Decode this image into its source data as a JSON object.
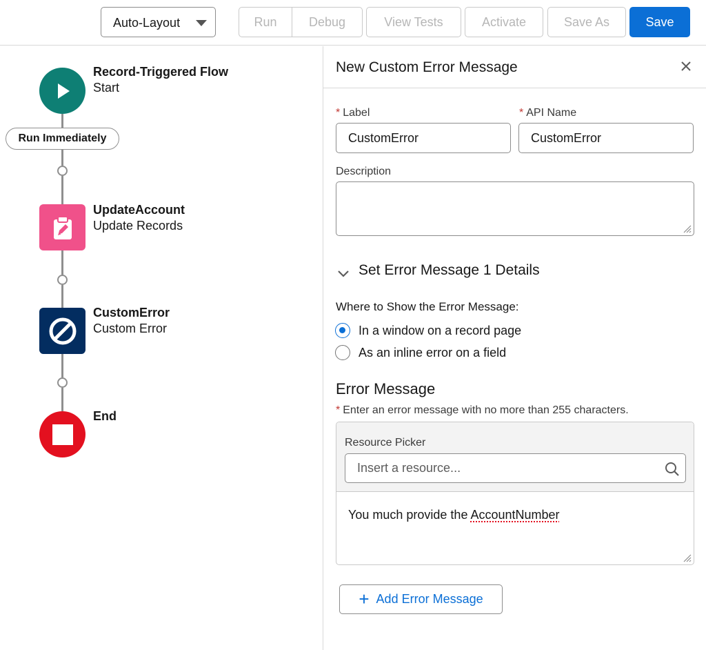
{
  "toolbar": {
    "layout_select": "Auto-Layout",
    "run": "Run",
    "debug": "Debug",
    "view_tests": "View Tests",
    "activate": "Activate",
    "save_as": "Save As",
    "save": "Save"
  },
  "flow": {
    "start": {
      "title": "Record-Triggered Flow",
      "subtitle": "Start"
    },
    "run_immediately": "Run Immediately",
    "update": {
      "title": "UpdateAccount",
      "subtitle": "Update Records"
    },
    "custom_error": {
      "title": "CustomError",
      "subtitle": "Custom Error"
    },
    "end": {
      "title": "End"
    }
  },
  "panel": {
    "title": "New Custom Error Message",
    "label_field": {
      "label": "Label",
      "value": "CustomError"
    },
    "api_name_field": {
      "label": "API Name",
      "value": "CustomError"
    },
    "description_label": "Description",
    "section_title": "Set Error Message 1 Details",
    "where_label": "Where to Show the Error Message:",
    "radio_options": [
      {
        "label": "In a window on a record page",
        "checked": true
      },
      {
        "label": "As an inline error on a field",
        "checked": false
      }
    ],
    "error_heading": "Error Message",
    "error_hint": "Enter an error message with no more than 255 characters.",
    "resource_picker_label": "Resource Picker",
    "resource_placeholder": "Insert a resource...",
    "message_prefix": "You much provide the ",
    "message_token": "AccountNumber",
    "add_error_button": "Add Error Message"
  },
  "colors": {
    "accent": "#0b6fd6",
    "start_node": "#0e7f74",
    "update_node": "#f0518a",
    "error_node": "#032d60",
    "end_node": "#e3101f",
    "required": "#c23934"
  },
  "icons": [
    "chevron-down-icon",
    "play-icon",
    "clipboard-edit-icon",
    "ban-icon",
    "stop-icon",
    "close-icon",
    "search-icon",
    "plus-icon"
  ]
}
